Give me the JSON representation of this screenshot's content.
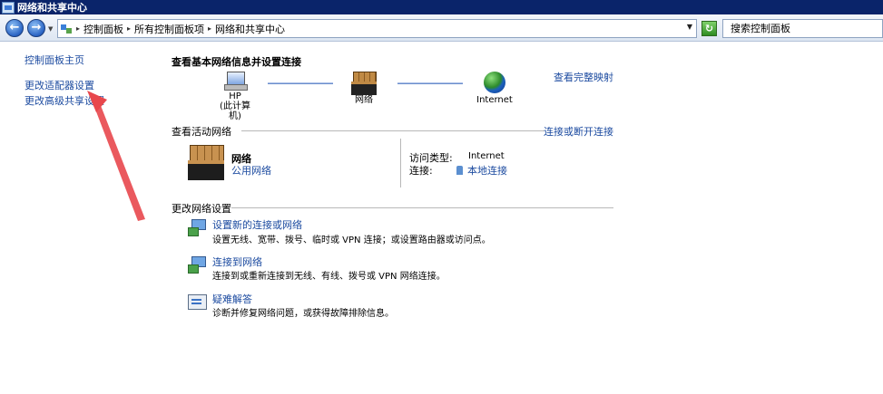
{
  "window": {
    "title": "网络和共享中心"
  },
  "address_bar": {
    "breadcrumbs": [
      "控制面板",
      "所有控制面板项",
      "网络和共享中心"
    ],
    "search_placeholder": "搜索控制面板"
  },
  "left_nav": {
    "items": [
      {
        "label": "控制面板主页"
      },
      {
        "label": "更改适配器设置"
      },
      {
        "label": "更改高级共享设置"
      }
    ]
  },
  "main": {
    "heading": "查看基本网络信息并设置连接",
    "full_map_link": "查看完整映射",
    "map": {
      "computer_name": "HP",
      "computer_sub": "(此计算机)",
      "network": "网络",
      "internet": "Internet"
    },
    "active_networks": {
      "label": "查看活动网络",
      "connect_link": "连接或断开连接",
      "network_name": "网络",
      "network_type": "公用网络",
      "access_type_label": "访问类型:",
      "access_type_value": "Internet",
      "connections_label": "连接:",
      "connections_value": "本地连接"
    },
    "change_settings": {
      "label": "更改网络设置",
      "tasks": [
        {
          "title": "设置新的连接或网络",
          "desc": "设置无线、宽带、拨号、临时或 VPN 连接；或设置路由器或访问点。"
        },
        {
          "title": "连接到网络",
          "desc": "连接到或重新连接到无线、有线、拨号或 VPN 网络连接。"
        },
        {
          "title": "疑难解答",
          "desc": "诊断并修复网络问题，或获得故障排除信息。"
        }
      ]
    }
  },
  "colors": {
    "link": "#1c4ba0",
    "titlebar": "#0a246a",
    "annotation": "#e8474c"
  }
}
